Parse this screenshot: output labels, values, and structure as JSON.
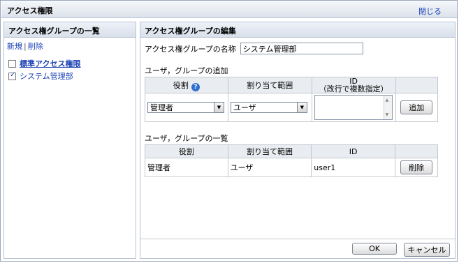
{
  "window": {
    "title": "アクセス権限",
    "close_label": "閉じる"
  },
  "left": {
    "header": "アクセス権グループの一覧",
    "new_link": "新規",
    "separator": "|",
    "delete_link": "削除",
    "groups": [
      {
        "label": "標準アクセス権限",
        "checked": false
      },
      {
        "label": "システム管理部",
        "checked": true
      }
    ]
  },
  "right": {
    "header": "アクセス権グループの編集",
    "name_label": "アクセス権グループの名称",
    "name_value": "システム管理部",
    "add_section_label": "ユーザ，グループの追加",
    "add_table": {
      "col_role": "役割",
      "col_scope": "割り当て範囲",
      "col_id_line1": "ID",
      "col_id_line2": "（改行で複数指定）",
      "role_value": "管理者",
      "scope_value": "ユーザ",
      "id_value": "",
      "add_button": "追加"
    },
    "list_section_label": "ユーザ，グループの一覧",
    "list_table": {
      "col_role": "役割",
      "col_scope": "割り当て範囲",
      "col_id": "ID",
      "rows": [
        {
          "role": "管理者",
          "scope": "ユーザ",
          "id": "user1",
          "delete_button": "削除"
        }
      ]
    },
    "ok_button": "OK",
    "cancel_button": "キャンセル"
  }
}
